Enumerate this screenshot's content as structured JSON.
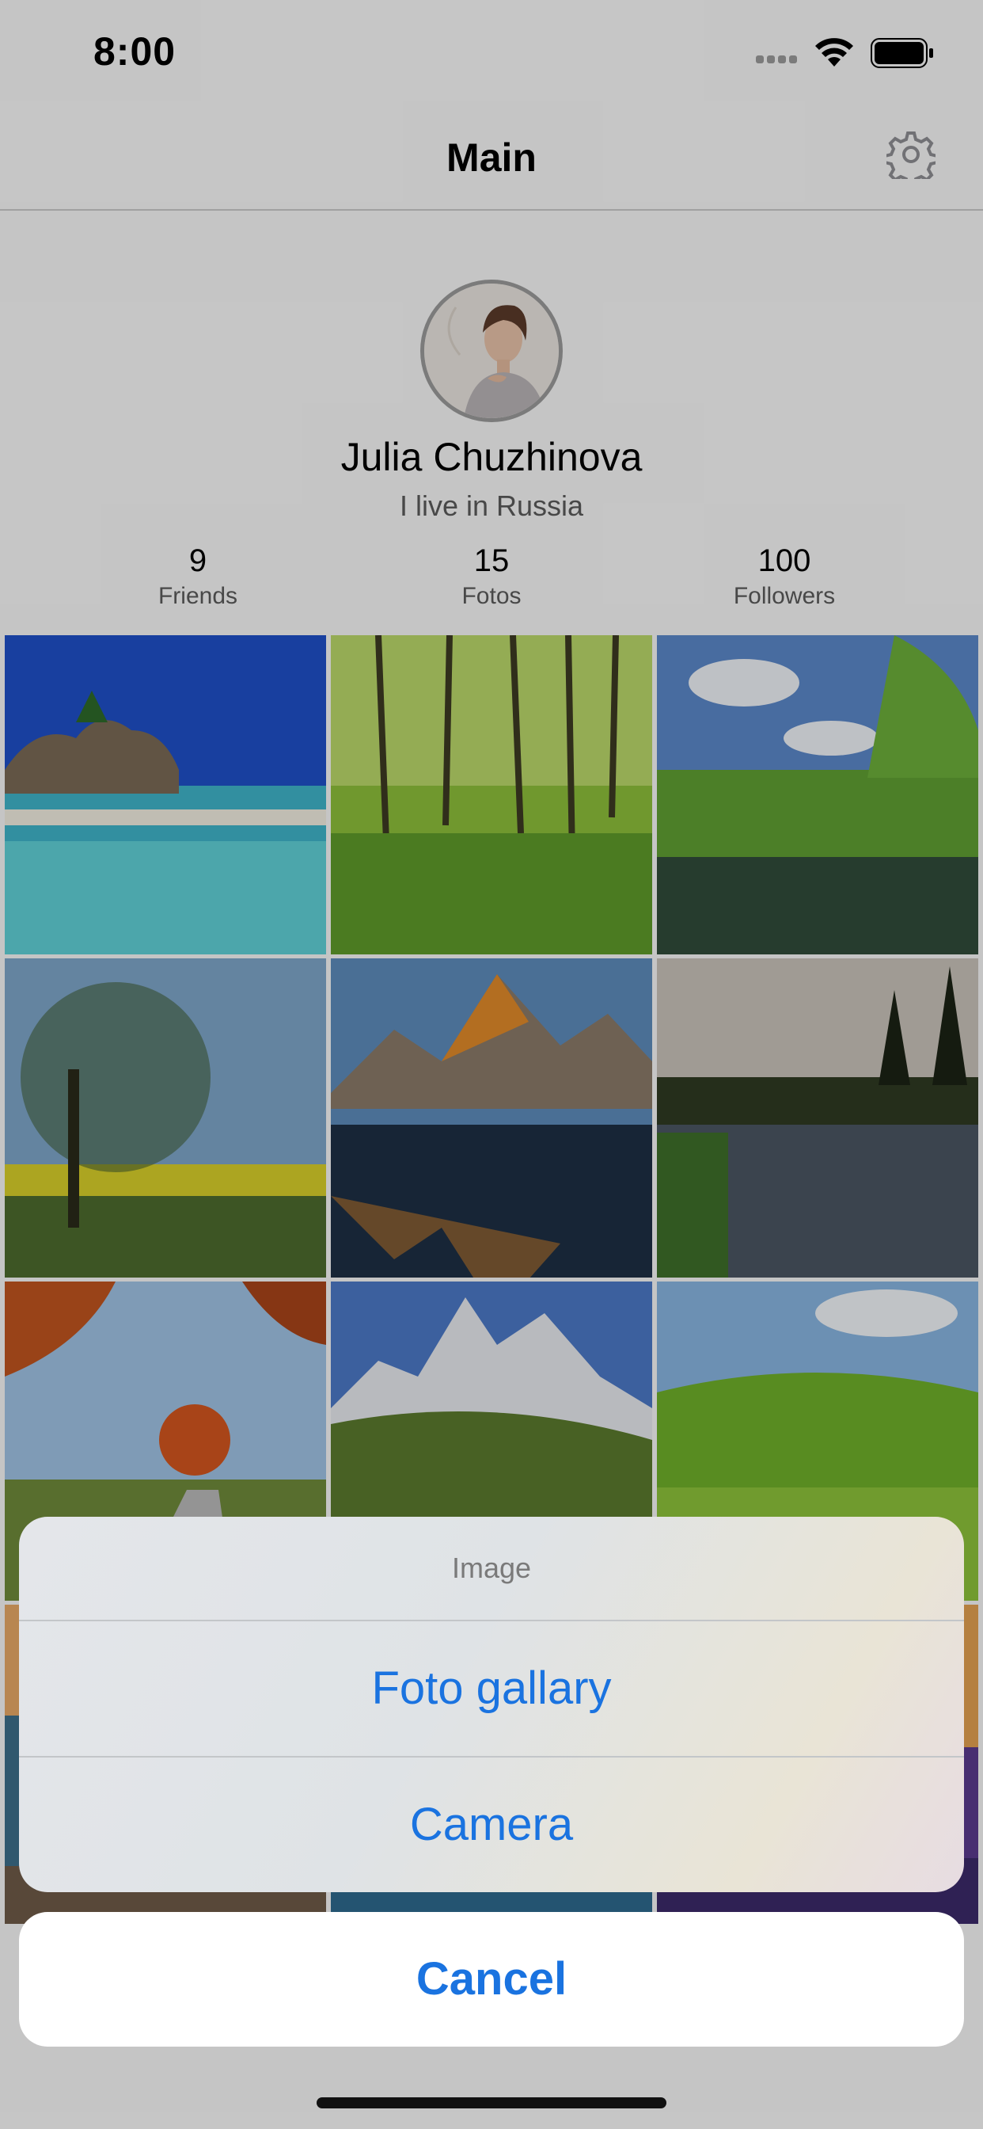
{
  "status_bar": {
    "time": "8:00"
  },
  "nav": {
    "title": "Main",
    "settings_icon": "gear-icon"
  },
  "profile": {
    "name": "Julia Chuzhinova",
    "bio": "I live in Russia",
    "stats": [
      {
        "value": "9",
        "label": "Friends"
      },
      {
        "value": "15",
        "label": "Fotos"
      },
      {
        "value": "100",
        "label": "Followers"
      }
    ]
  },
  "action_sheet": {
    "title": "Image",
    "options": [
      "Foto gallary",
      "Camera"
    ],
    "cancel_label": "Cancel"
  },
  "colors": {
    "accent": "#1a73e0",
    "background": "#f7f7f7"
  }
}
